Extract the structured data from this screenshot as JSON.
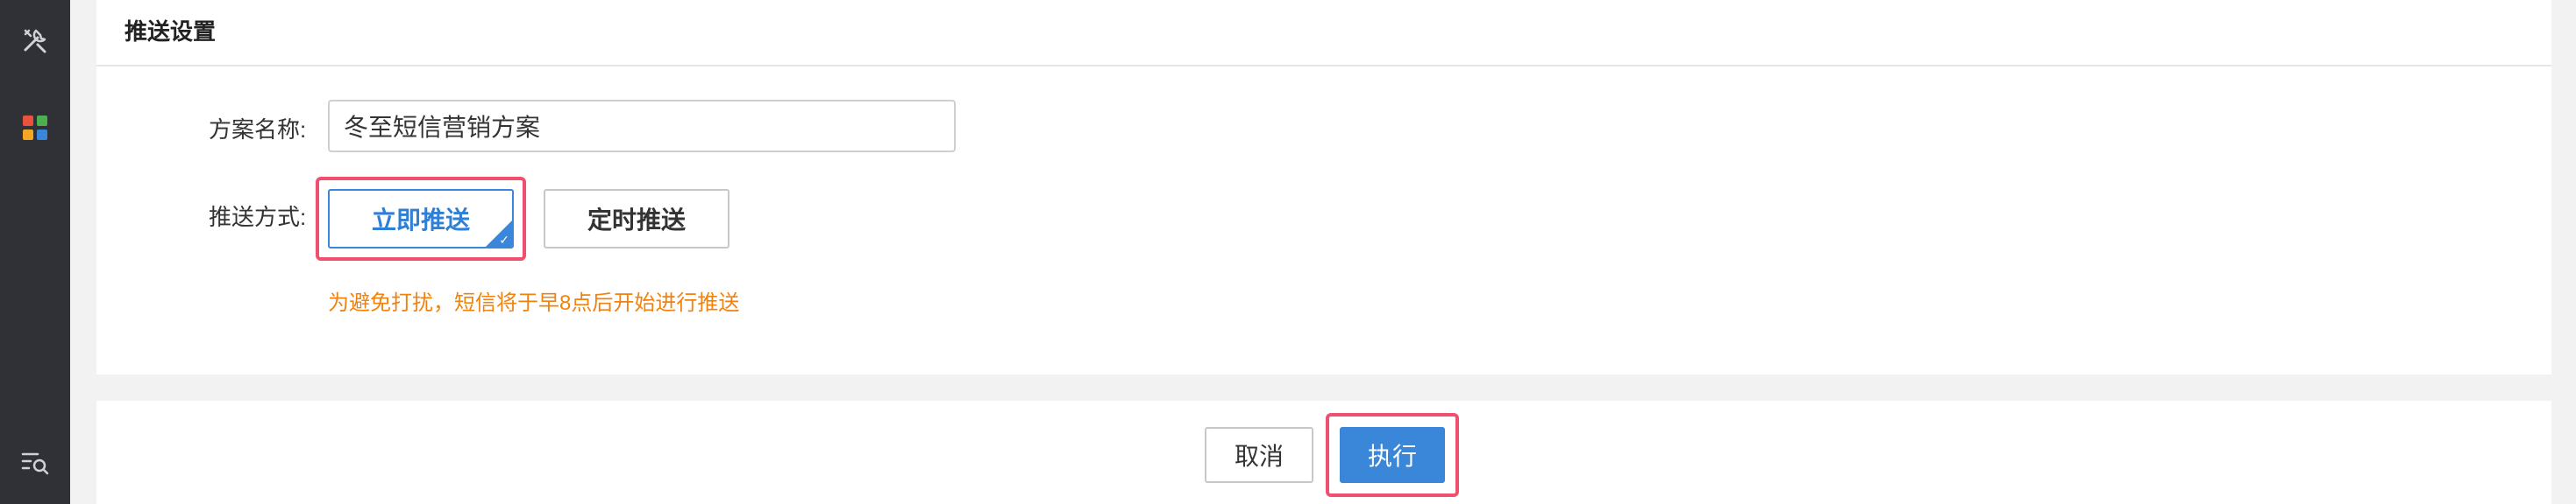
{
  "sidebar": {
    "icons": [
      "tools-icon",
      "apps-grid-icon",
      "list-search-icon"
    ]
  },
  "push_settings": {
    "title": "推送设置",
    "plan_name_label": "方案名称:",
    "plan_name_value": "冬至短信营销方案",
    "push_method_label": "推送方式:",
    "options": [
      {
        "label": "立即推送",
        "selected": true
      },
      {
        "label": "定时推送",
        "selected": false
      }
    ],
    "hint": "为避免打扰，短信将于早8点后开始进行推送"
  },
  "footer": {
    "cancel_label": "取消",
    "run_label": "执行"
  },
  "colors": {
    "sidebar_bg": "#2f3136",
    "accent": "#3a86d9",
    "hint": "#f0830f",
    "highlight": "#f0506e"
  }
}
